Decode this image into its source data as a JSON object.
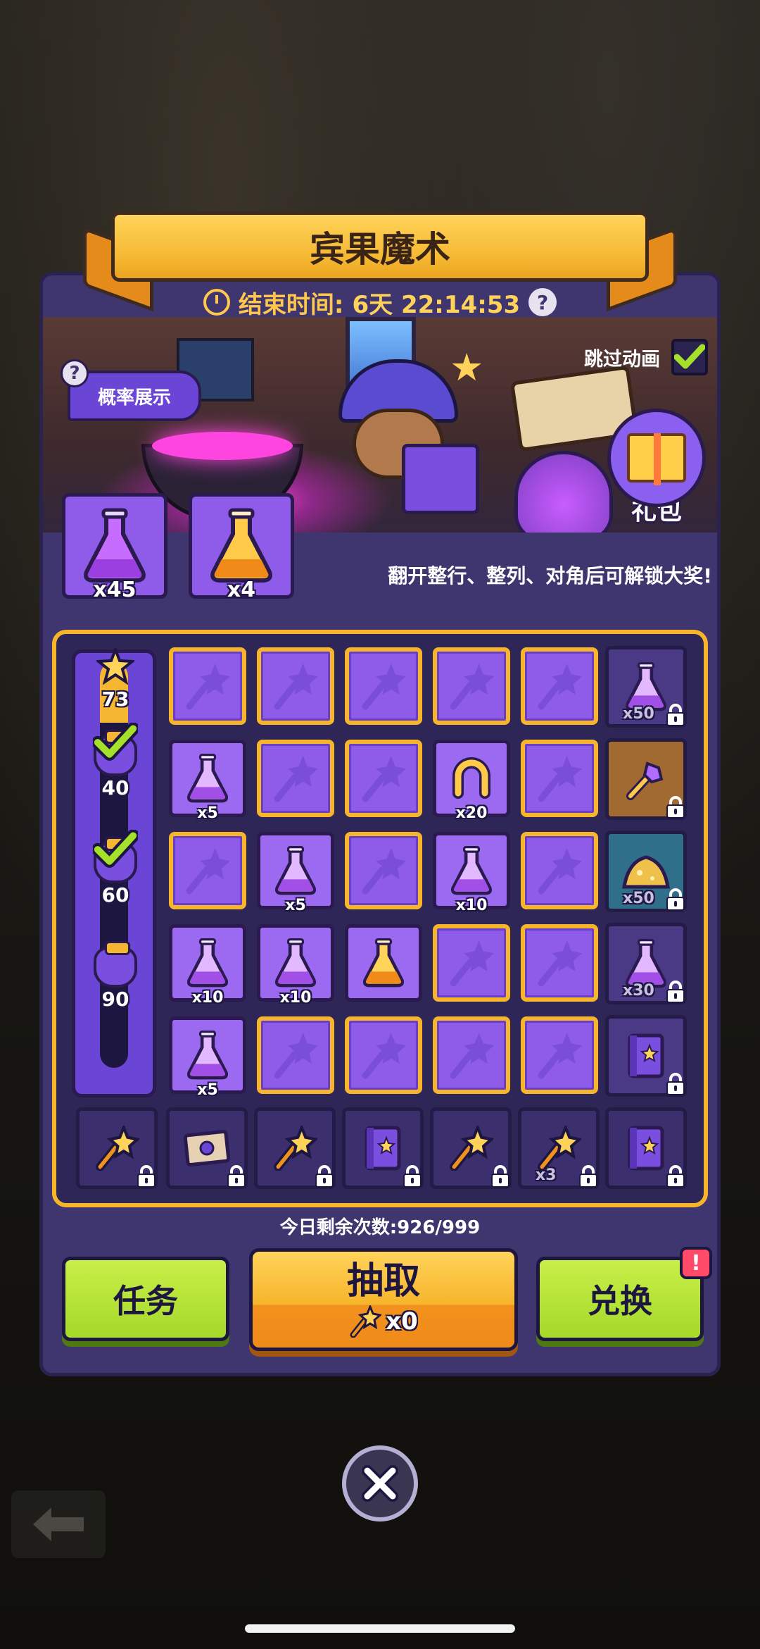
{
  "title": "宾果魔术",
  "timer": {
    "label": "结束时间:",
    "value": "6天 22:14:53"
  },
  "scene": {
    "probability_label": "概率展示",
    "skip_label": "跳过动画",
    "skip_checked": true,
    "gift_label": "礼包"
  },
  "potions": [
    {
      "icon": "purple-potion-icon",
      "count": "x45"
    },
    {
      "icon": "orange-potion-icon",
      "count": "x4"
    }
  ],
  "unlock_hint": "翻开整行、整列、对角后可解锁大奖!",
  "progress": {
    "current": 73,
    "fraction": 0.15,
    "milestones": [
      {
        "value": "73",
        "type": "star",
        "claimed": false
      },
      {
        "value": "40",
        "type": "bag",
        "claimed": true
      },
      {
        "value": "60",
        "type": "bag",
        "claimed": true
      },
      {
        "value": "90",
        "type": "bag",
        "claimed": false
      }
    ]
  },
  "grid": [
    [
      {
        "state": "hidden"
      },
      {
        "state": "hidden"
      },
      {
        "state": "hidden"
      },
      {
        "state": "hidden"
      },
      {
        "state": "hidden"
      }
    ],
    [
      {
        "state": "revealed",
        "icon": "purple-potion-icon",
        "count": "x5"
      },
      {
        "state": "hidden"
      },
      {
        "state": "hidden"
      },
      {
        "state": "revealed",
        "icon": "horseshoe-icon",
        "count": "x20"
      },
      {
        "state": "hidden"
      }
    ],
    [
      {
        "state": "hidden"
      },
      {
        "state": "revealed",
        "icon": "purple-potion-icon",
        "count": "x5"
      },
      {
        "state": "hidden"
      },
      {
        "state": "revealed",
        "icon": "purple-potion-icon",
        "count": "x10"
      },
      {
        "state": "hidden"
      }
    ],
    [
      {
        "state": "revealed",
        "icon": "purple-potion-icon",
        "count": "x10"
      },
      {
        "state": "revealed",
        "icon": "purple-potion-icon",
        "count": "x10"
      },
      {
        "state": "revealed",
        "icon": "orange-potion-icon",
        "count": ""
      },
      {
        "state": "hidden"
      },
      {
        "state": "hidden"
      }
    ],
    [
      {
        "state": "revealed",
        "icon": "purple-potion-icon",
        "count": "x5"
      },
      {
        "state": "hidden"
      },
      {
        "state": "hidden"
      },
      {
        "state": "hidden"
      },
      {
        "state": "hidden"
      }
    ]
  ],
  "row_rewards": [
    {
      "icon": "purple-potion-icon",
      "count": "x50",
      "style": "locked-purple"
    },
    {
      "icon": "key-scepter-icon",
      "count": "",
      "style": "locked-orange"
    },
    {
      "icon": "gold-pile-icon",
      "count": "x50",
      "style": "locked-teal"
    },
    {
      "icon": "purple-potion-icon",
      "count": "x30",
      "style": "locked-purple"
    },
    {
      "icon": "spellbook-icon",
      "count": "",
      "style": "locked-purple"
    }
  ],
  "column_rewards": [
    {
      "icon": "magic-wand-icon",
      "count": "",
      "style": "reward"
    },
    {
      "icon": "scroll-ticket-icon",
      "count": "",
      "style": "locked-orange"
    },
    {
      "icon": "magic-wand-icon",
      "count": "",
      "style": "reward"
    },
    {
      "icon": "spellbook-icon",
      "count": "",
      "style": "reward"
    },
    {
      "icon": "magic-wand-icon",
      "count": "",
      "style": "reward"
    },
    {
      "icon": "magic-wand-icon",
      "count": "x3",
      "style": "reward"
    },
    {
      "icon": "spellbook-icon",
      "count": "",
      "style": "reward"
    }
  ],
  "remaining_text": "今日剩余次数:926/999",
  "buttons": {
    "tasks": "任务",
    "draw": "抽取",
    "draw_cost": "x0",
    "exchange": "兑换",
    "exchange_alert": "!"
  },
  "colors": {
    "accent": "#f7b52b",
    "panel": "#3f3670",
    "tile": "#8e5ce8",
    "green": "#a5d92a"
  }
}
